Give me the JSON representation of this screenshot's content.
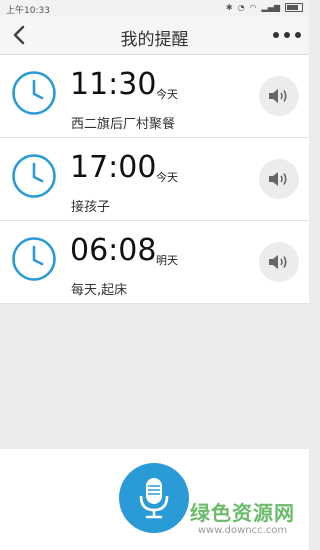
{
  "status_bar": {
    "time": "上午10:33"
  },
  "header": {
    "title": "我的提醒",
    "back_icon": "chevron-left-icon",
    "more_icon": "more-dots-icon"
  },
  "reminders": [
    {
      "time": "11:30",
      "day": "今天",
      "label": "西二旗后厂村聚餐"
    },
    {
      "time": "17:00",
      "day": "今天",
      "label": "接孩子"
    },
    {
      "time": "06:08",
      "day": "明天",
      "label": "每天,起床"
    }
  ],
  "mic": {
    "icon": "microphone-icon",
    "color": "#2a9bd6"
  },
  "watermark": {
    "title": "绿色资源网",
    "url": "www.downcc.com"
  },
  "colors": {
    "clock": "#2a9bd6",
    "background": "#ececec"
  }
}
